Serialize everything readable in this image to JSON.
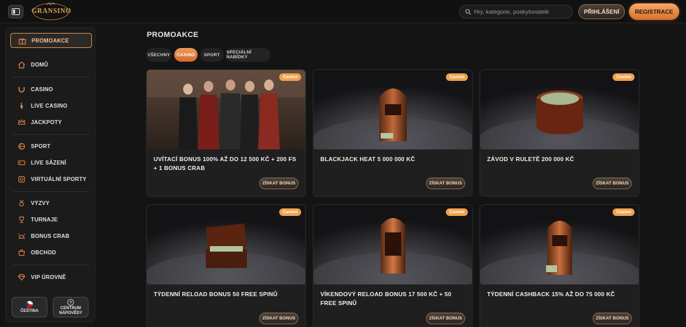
{
  "header": {
    "logo_text": "GRANSINO",
    "search_placeholder": "Hry, kategorie, poskytovatelé",
    "login_label": "PŘIHLÁŠENÍ",
    "register_label": "REGISTRACE"
  },
  "sidebar": {
    "items": [
      {
        "label": "PROMOAKCE",
        "icon": "gift-icon"
      },
      {
        "label": "DOMŮ",
        "icon": "home-icon"
      },
      {
        "label": "CASINO",
        "icon": "horseshoe-icon"
      },
      {
        "label": "LIVE CASINO",
        "icon": "live-icon"
      },
      {
        "label": "JACKPOTY",
        "icon": "crown-icon"
      },
      {
        "label": "SPORT",
        "icon": "ball-icon"
      },
      {
        "label": "LIVE SÁZENÍ",
        "icon": "live-bet-icon"
      },
      {
        "label": "VIRTUÁLNÍ SPORTY",
        "icon": "virtual-icon"
      },
      {
        "label": "VÝZVY",
        "icon": "medal-icon"
      },
      {
        "label": "TURNAJE",
        "icon": "trophy-icon"
      },
      {
        "label": "BONUS CRAB",
        "icon": "crab-icon"
      },
      {
        "label": "OBCHOD",
        "icon": "shop-icon"
      },
      {
        "label": "VIP ÚROVNĚ",
        "icon": "diamond-icon"
      }
    ],
    "language_label": "ČEŠTINA",
    "help_label_1": "CENTRUM",
    "help_label_2": "NÁPOVĚDY"
  },
  "main": {
    "title": "PROMOAKCE",
    "tabs": [
      "VŠECHNY",
      "CASINO",
      "SPORT",
      "SPECIÁLNÍ NABÍDKY"
    ],
    "active_tab": "CASINO"
  },
  "cards": [
    {
      "badge": "Casino",
      "title": "UVÍTACÍ BONUS 100% AŽ DO 12 500 KČ + 200 FS + 1 BONUS CRAB",
      "button": "ZÍSKAT BONUS"
    },
    {
      "badge": "Casino",
      "title": "BLACKJACK HEAT 5 000 000 KČ",
      "button": "ZÍSKAT BONUS"
    },
    {
      "badge": "Casino",
      "title": "ZÁVOD V RULETĚ 200 000 KČ",
      "button": "ZÍSKAT BONUS"
    },
    {
      "badge": "Casino",
      "title": "TÝDENNÍ RELOAD BONUS 50 FREE SPINŮ",
      "button": "ZÍSKAT BONUS"
    },
    {
      "badge": "Casino",
      "title": "VÍKENDOVÝ RELOAD BONUS 17 500 KČ + 50 FREE SPINŮ",
      "button": "ZÍSKAT BONUS"
    },
    {
      "badge": "Casino",
      "title": "TÝDENNÍ CASHBACK 15% AŽ DO 75 000 KČ",
      "button": "ZÍSKAT BONUS"
    }
  ],
  "colors": {
    "accent": "#e27a35",
    "gold": "#d8a25e",
    "bg": "#141414"
  }
}
